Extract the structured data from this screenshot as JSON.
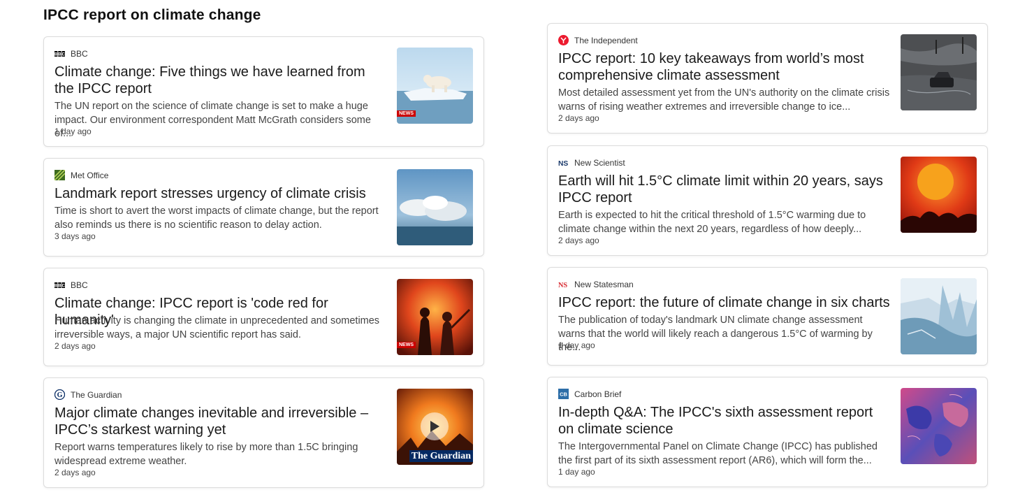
{
  "page": {
    "title": "IPCC report on climate change"
  },
  "left_articles": [
    {
      "source": "BBC",
      "headline": "Climate change: Five things we have learned from the IPCC report",
      "snippet": "The UN report on the science of climate change is set to make a huge impact. Our environment correspondent Matt McGrath considers some of...",
      "age": "1 day ago",
      "thumb_tag": "NEWS"
    },
    {
      "source": "Met Office",
      "headline": "Landmark report stresses urgency of climate crisis",
      "snippet": "Time is short to avert the worst impacts of climate change, but the report also reminds us there is no scientific reason to delay action.",
      "age": "3 days ago"
    },
    {
      "source": "BBC",
      "headline": "Climate change: IPCC report is 'code red for humanity'",
      "snippet": "Human activity is changing the climate in unprecedented and sometimes irreversible ways, a major UN scientific report has said.",
      "age": "2 days ago",
      "thumb_tag": "NEWS"
    },
    {
      "source": "The Guardian",
      "headline": "Major climate changes inevitable and irreversible – IPCC’s starkest warning yet",
      "snippet": "Report warns temperatures likely to rise by more than 1.5C bringing widespread extreme weather.",
      "age": "2 days ago",
      "thumb_tag": "The Guardian"
    }
  ],
  "right_articles": [
    {
      "source": "The Independent",
      "headline": "IPCC report: 10 key takeaways from world’s most comprehensive climate assessment",
      "snippet": "Most detailed assessment yet from the UN's authority on the climate crisis warns of rising weather extremes and irreversible change to ice...",
      "age": "2 days ago"
    },
    {
      "source": "New Scientist",
      "headline": "Earth will hit 1.5°C climate limit within 20 years, says IPCC report",
      "snippet": "Earth is expected to hit the critical threshold of 1.5°C warming due to climate change within the next 20 years, regardless of how deeply...",
      "age": "2 days ago"
    },
    {
      "source": "New Statesman",
      "headline": "IPCC report: the future of climate change in six charts",
      "snippet": "The publication of today's landmark UN climate change assessment warns that the world will likely reach a dangerous 1.5°C of warming by the...",
      "age": "1 day ago"
    },
    {
      "source": "Carbon Brief",
      "headline": "In-depth Q&A: The IPCC's sixth assessment report on climate science",
      "snippet": "The Intergovernmental Panel on Climate Change (IPCC) has published the first part of its sixth assessment report (AR6), which will form the...",
      "age": "1 day ago"
    }
  ],
  "colors": {
    "bbc": "#000000",
    "independent": "#ec1a2e",
    "new_statesman": "#d7282f",
    "new_scientist": "#1b3a6b",
    "guardian": "#052962",
    "carbon_brief": "#2d6ea8"
  }
}
